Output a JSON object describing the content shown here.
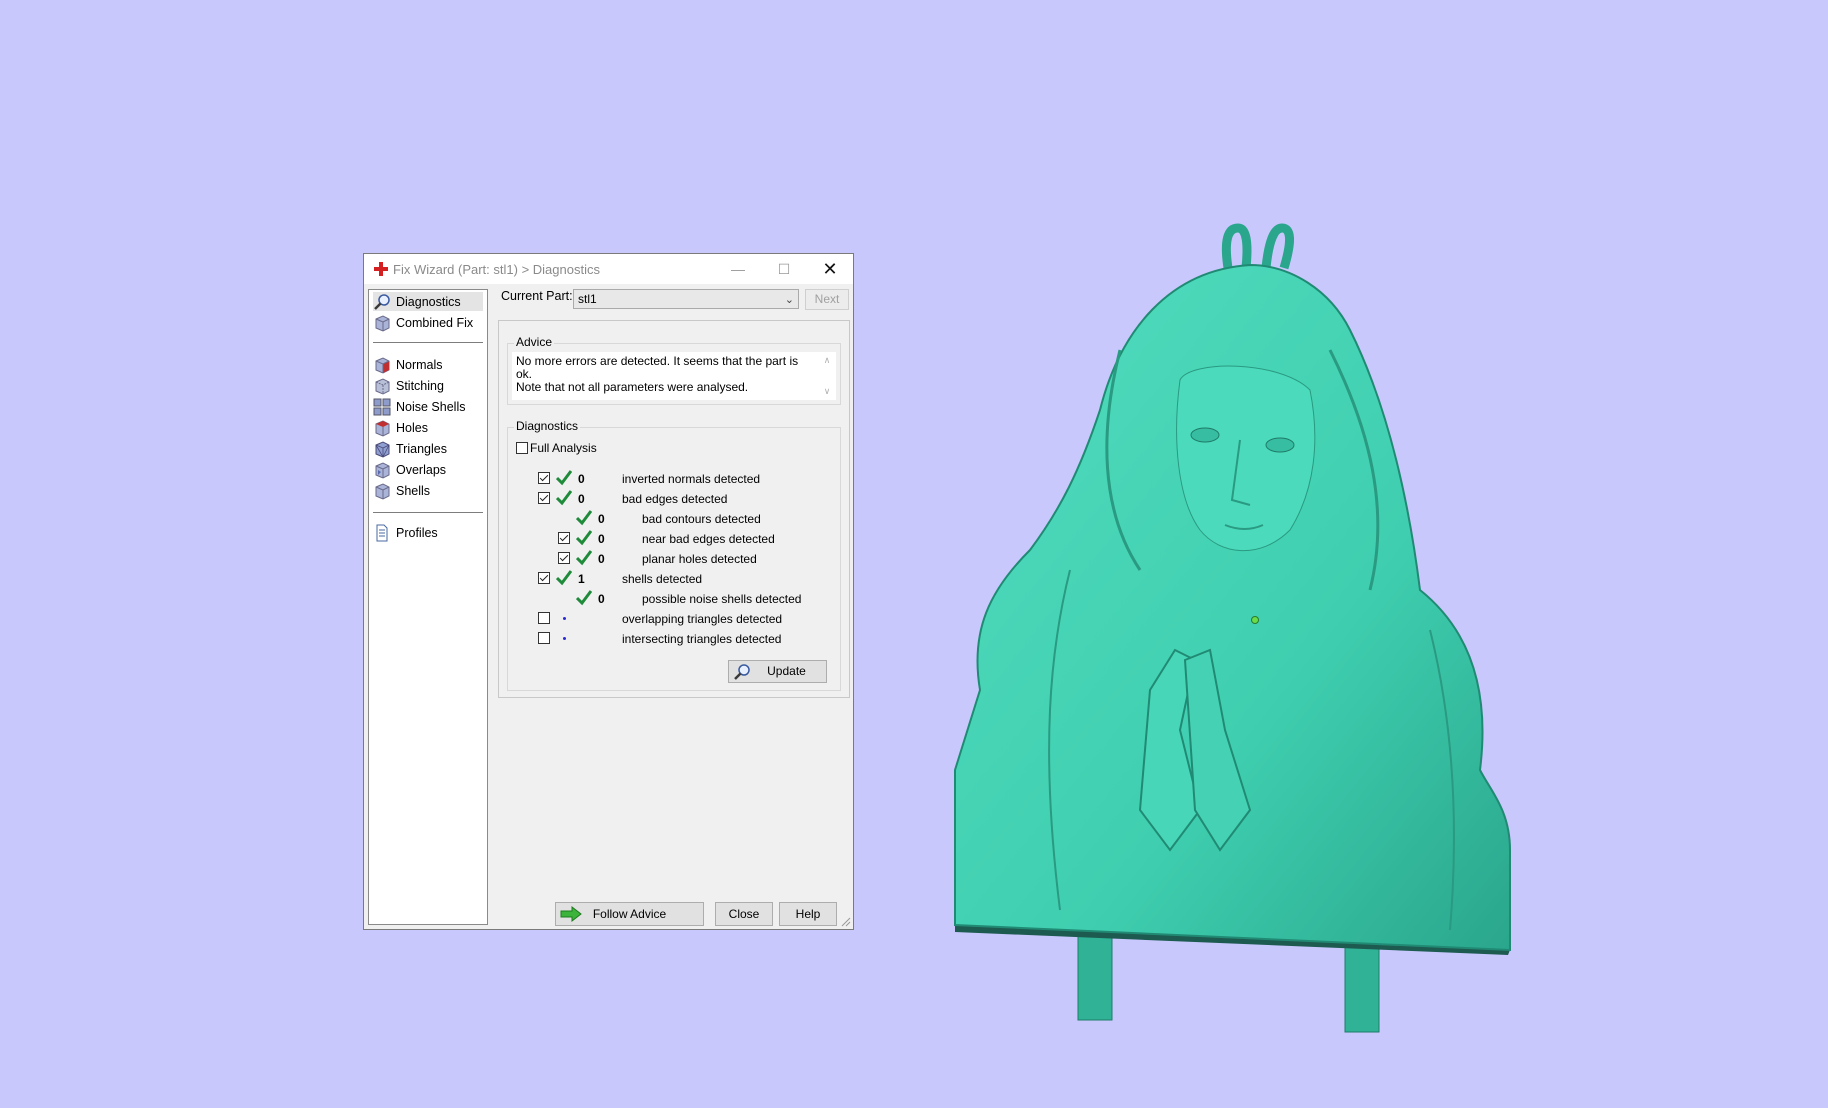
{
  "window": {
    "title": "Fix Wizard (Part: stl1) > Diagnostics",
    "minimize": "—",
    "maximize": "☐",
    "close": "✕"
  },
  "sidebar": {
    "items": [
      {
        "label": "Diagnostics",
        "icon": "magnifier-icon"
      },
      {
        "label": "Combined Fix",
        "icon": "cube-icon"
      },
      {
        "label": "Normals",
        "icon": "normals-cube-icon"
      },
      {
        "label": "Stitching",
        "icon": "stitching-cube-icon"
      },
      {
        "label": "Noise Shells",
        "icon": "noise-shells-icon"
      },
      {
        "label": "Holes",
        "icon": "holes-cube-icon"
      },
      {
        "label": "Triangles",
        "icon": "triangles-cube-icon"
      },
      {
        "label": "Overlaps",
        "icon": "overlaps-cube-icon"
      },
      {
        "label": "Shells",
        "icon": "shells-cube-icon"
      },
      {
        "label": "Profiles",
        "icon": "document-icon"
      }
    ]
  },
  "top": {
    "current_part_label": "Current Part:",
    "current_part_value": "stl1",
    "next_label": "Next"
  },
  "advice": {
    "group_label": "Advice",
    "text_line1": "No more errors are detected. It seems that the part is ok.",
    "text_line2": "Note that not all parameters were analysed."
  },
  "diagnostics": {
    "group_label": "Diagnostics",
    "full_analysis_label": "Full Analysis",
    "rows": [
      {
        "count": "0",
        "text": "inverted normals detected"
      },
      {
        "count": "0",
        "text": "bad edges detected"
      },
      {
        "count": "0",
        "text": "bad contours detected"
      },
      {
        "count": "0",
        "text": "near bad edges detected"
      },
      {
        "count": "0",
        "text": "planar holes detected"
      },
      {
        "count": "1",
        "text": "shells detected"
      },
      {
        "count": "0",
        "text": "possible noise shells detected"
      },
      {
        "count": "",
        "text": "overlapping triangles detected"
      },
      {
        "count": "",
        "text": "intersecting triangles detected"
      }
    ],
    "update_label": "Update"
  },
  "footer": {
    "follow_advice_label": "Follow Advice",
    "close_label": "Close",
    "help_label": "Help"
  },
  "colors": {
    "background": "#c8c8fc",
    "model": "#3fcfb0",
    "check": "#1f8a3a"
  }
}
